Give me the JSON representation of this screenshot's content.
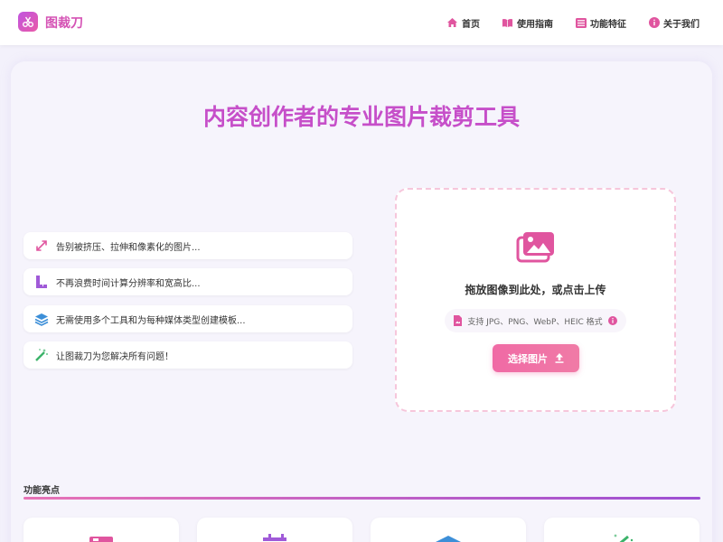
{
  "app": {
    "name": "图裁刀"
  },
  "nav": {
    "links": [
      {
        "label": "首页",
        "icon": "home-icon"
      },
      {
        "label": "使用指南",
        "icon": "book-icon"
      },
      {
        "label": "功能特征",
        "icon": "list-icon"
      },
      {
        "label": "关于我们",
        "icon": "info-icon"
      }
    ]
  },
  "hero": {
    "title": "内容创作者的专业图片裁剪工具"
  },
  "features": [
    {
      "text": "告别被挤压、拉伸和像素化的图片...",
      "icon": "expand-arrows-icon"
    },
    {
      "text": "不再浪费时间计算分辨率和宽高比...",
      "icon": "ruler-icon"
    },
    {
      "text": "无需使用多个工具和为每种媒体类型创建模板...",
      "icon": "layers-icon"
    },
    {
      "text": "让图裁刀为您解决所有问题！",
      "icon": "magic-wand-icon"
    }
  ],
  "upload": {
    "title": "拖放图像到此处，或点击上传",
    "formats": "支持 JPG、PNG、WebP、HEIC 格式",
    "button_label": "选择图片"
  },
  "highlights": {
    "title": "功能亮点"
  },
  "colors": {
    "brand_pink": "#e95aa8",
    "brand_purple": "#c055e0",
    "background": "#f3f1fb"
  }
}
